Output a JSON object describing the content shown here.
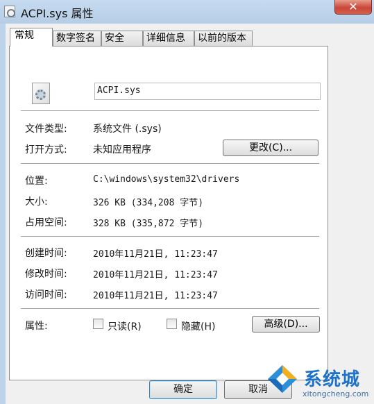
{
  "window": {
    "title": "ACPI.sys 属性",
    "close_glyph": "✕"
  },
  "tabs": [
    {
      "label": "常规"
    },
    {
      "label": "数字签名"
    },
    {
      "label": "安全"
    },
    {
      "label": "详细信息"
    },
    {
      "label": "以前的版本"
    }
  ],
  "general": {
    "icon": "system-file-icon",
    "file_name": "ACPI.sys",
    "file_type_label": "文件类型:",
    "file_type_value": "系统文件 (.sys)",
    "opens_with_label": "打开方式:",
    "opens_with_value": "未知应用程序",
    "change_button": "更改(C)...",
    "location_label": "位置:",
    "location_value": "C:\\windows\\system32\\drivers",
    "size_label": "大小:",
    "size_value": "326 KB (334,208 字节)",
    "size_on_disk_label": "占用空间:",
    "size_on_disk_value": "328 KB (335,872 字节)",
    "created_label": "创建时间:",
    "created_value": "2010年11月21日, 11:23:47",
    "modified_label": "修改时间:",
    "modified_value": "2010年11月21日, 11:23:47",
    "accessed_label": "访问时间:",
    "accessed_value": "2010年11月21日, 11:23:47",
    "attributes_label": "属性:",
    "readonly_label": "只读(R)",
    "readonly_checked": false,
    "hidden_label": "隐藏(H)",
    "hidden_checked": false,
    "advanced_button": "高级(D)..."
  },
  "footer": {
    "ok_button": "确定",
    "cancel_button": "取消"
  },
  "watermark": {
    "brand": "系统城",
    "url": "xitongcheng.com"
  }
}
